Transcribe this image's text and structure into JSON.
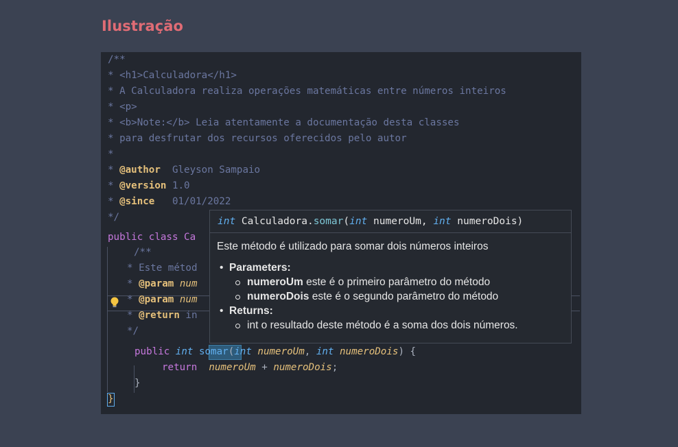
{
  "heading": "Ilustração",
  "code": {
    "javadoc": {
      "open": "/**",
      "h1_line": "* <h1>Calculadora</h1>",
      "desc_line": "* A Calculadora realiza operações matemáticas entre números inteiros",
      "p_line": "* <p>",
      "note_line": "* <b>Note:</b> Leia atentamente a documentação desta classes",
      "para_line": "* para desfrutar dos recursos oferecidos pelo autor",
      "blank_line": "*",
      "star": "* ",
      "author_tag": "@author",
      "author_val": "  Gleyson Sampaio",
      "version_tag": "@version",
      "version_val": " 1.0",
      "since_tag": "@since",
      "since_val": "   01/01/2022",
      "close": "*/"
    },
    "class_decl": "public class Ca",
    "method_doc": {
      "open": "/**",
      "desc": "* Este métod",
      "star": "* ",
      "param_tag": "@param",
      "param1_val": " num",
      "param2_val": " num",
      "return_tag": "@return",
      "return_val": " in",
      "close": "*/"
    },
    "method": {
      "public": "public",
      "int1": "int",
      "name": "somar",
      "paren_open": "(",
      "int2": "int",
      "p1": "numeroUm",
      "comma": ", ",
      "int3": "int",
      "p2": "numeroDois",
      "paren_close": ") {",
      "return_kw": "return",
      "r1": "numeroUm",
      "plus": " + ",
      "r2": "numeroDois",
      "semicolon": ";",
      "close_brace": "}"
    },
    "class_close": "}"
  },
  "tooltip": {
    "sig_int1": "int",
    "sig_class": " Calculadora.",
    "sig_method": "somar",
    "sig_paren": "(",
    "sig_int2": "int",
    "sig_p1": " numeroUm, ",
    "sig_int3": "int",
    "sig_p2": " numeroDois)",
    "description": "Este método é utilizado para somar dois números inteiros",
    "parameters_label": "Parameters:",
    "params": [
      {
        "name": "numeroUm",
        "desc": " este é o primeiro parâmetro do método"
      },
      {
        "name": "numeroDois",
        "desc": " este é o segundo parâmetro do método"
      }
    ],
    "returns_label": "Returns:",
    "returns_desc": "int o resultado deste método é a soma dos dois números."
  },
  "colors": {
    "background": "#3b4252",
    "heading": "#e06c75",
    "editor_bg": "#23272f",
    "comment": "#6b77a0",
    "javadoc_tag": "#e5c07b",
    "keyword": "#c678dd",
    "type": "#61afef"
  },
  "icons": [
    "lightbulb-icon"
  ]
}
